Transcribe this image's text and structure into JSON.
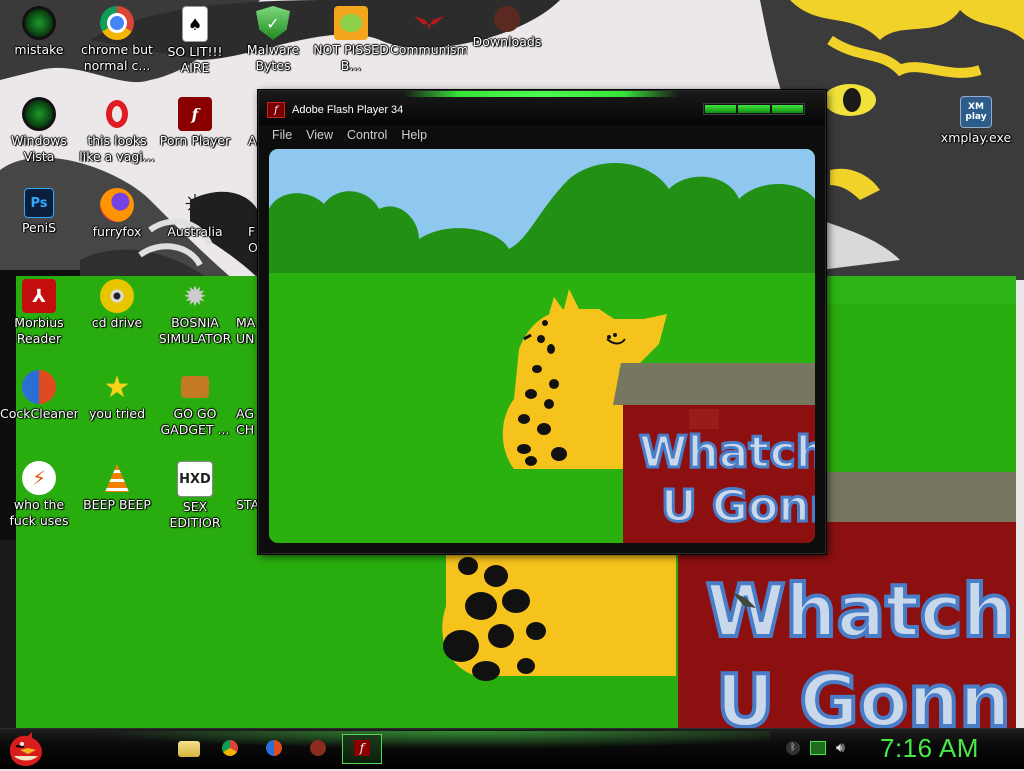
{
  "desktop": {
    "icons": [
      {
        "label": "mistake",
        "icon": "green-orb-icon"
      },
      {
        "label": "chrome but normal c...",
        "icon": "chrome-icon"
      },
      {
        "label": "SO LIT!!! AIRE",
        "icon": "playing-card-icon"
      },
      {
        "label": "Malware Bytes",
        "icon": "shield-check-icon"
      },
      {
        "label": "NOT PISSED B...",
        "icon": "angry-pig-icon"
      },
      {
        "label": "Communism",
        "icon": "winged-emblem-icon"
      },
      {
        "label": "Downloads",
        "icon": "folder-creature-icon"
      },
      {
        "label": "Windows Vista",
        "icon": "green-orb-icon"
      },
      {
        "label": "this looks like a vagi...",
        "icon": "opera-icon"
      },
      {
        "label": "Porn Player",
        "icon": "flash-icon"
      },
      {
        "label": "A",
        "icon": "partial-icon"
      },
      {
        "label": "PeniS",
        "icon": "photoshop-icon"
      },
      {
        "label": "furryfox",
        "icon": "firefox-icon"
      },
      {
        "label": "Australia",
        "icon": "spider-icon"
      },
      {
        "label": "F Of",
        "icon": "partial-icon"
      },
      {
        "label": "Morbius Reader",
        "icon": "pdf-reader-icon"
      },
      {
        "label": "cd drive",
        "icon": "cd-icon"
      },
      {
        "label": "BOSNIA SIMULATOR",
        "icon": "gear-sphere-icon"
      },
      {
        "label": "MA UN",
        "icon": "partial-icon"
      },
      {
        "label": "CockCleaner",
        "icon": "ccleaner-icon"
      },
      {
        "label": "you tried",
        "icon": "star-icon"
      },
      {
        "label": "GO GO GADGET ...",
        "icon": "briefcase-icon"
      },
      {
        "label": "AG CH",
        "icon": "partial-icon"
      },
      {
        "label": "who the fuck uses this",
        "icon": "lightning-icon"
      },
      {
        "label": "BEEP BEEP",
        "icon": "vlc-cone-icon"
      },
      {
        "label": "SEX EDITIOR",
        "icon": "hxd-icon"
      },
      {
        "label": "STA",
        "icon": "partial-icon"
      }
    ],
    "right_icon": {
      "label": "xmplay.exe",
      "icon": "xmplay-icon",
      "badge_text": "XM play"
    }
  },
  "flash_window": {
    "title": "Adobe Flash Player 34",
    "menu": [
      "File",
      "View",
      "Control",
      "Help"
    ],
    "sign_text_line1": "Whatch",
    "sign_text_line2": "U Gonn"
  },
  "background_sign": {
    "line1": "Whatch",
    "line2": "U Gonn"
  },
  "taskbar": {
    "start_icon": "angry-bird-icon",
    "pinned": [
      "folder-icon",
      "chrome-icon",
      "ccleaner-icon",
      "creature-icon",
      "flash-icon"
    ],
    "tray_icons": [
      "bluetooth-icon",
      "network-icon",
      "volume-icon"
    ],
    "clock": "7:16 AM"
  },
  "colors": {
    "accent_green": "#48e848",
    "grass": "#2ab10f",
    "sign_red": "#8c1010",
    "leopard_yellow": "#f6c21c"
  }
}
